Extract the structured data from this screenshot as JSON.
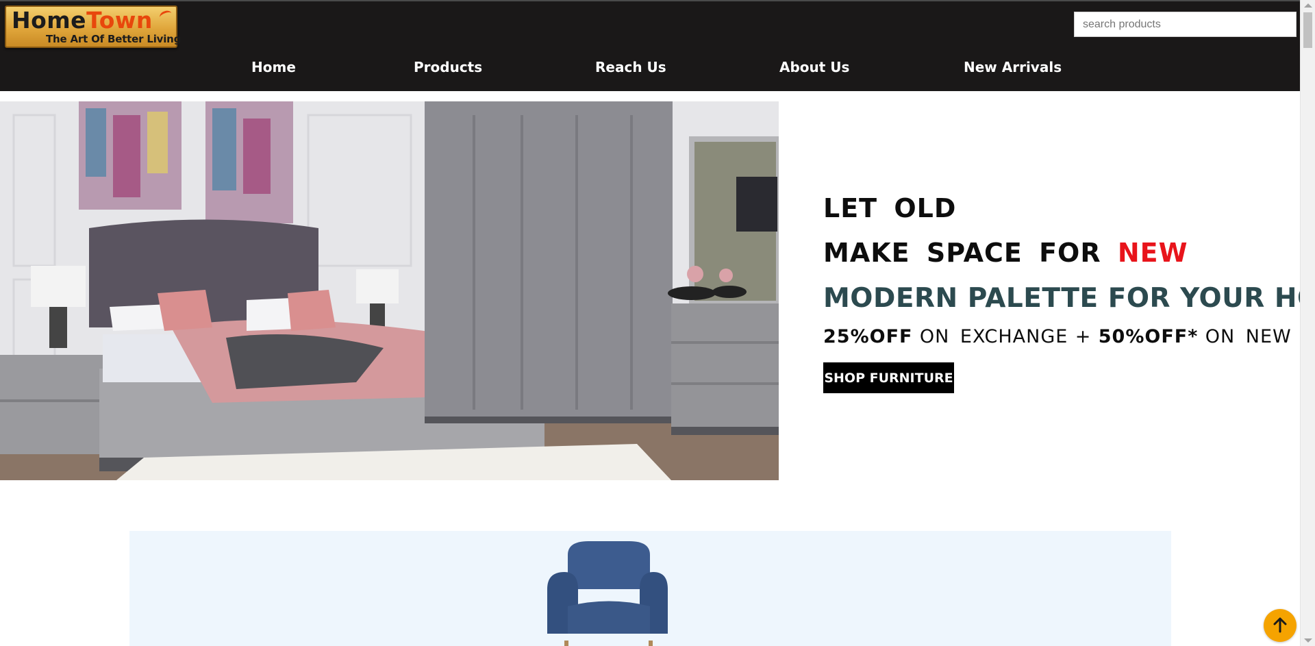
{
  "brand": {
    "name_part1": "Home",
    "name_part2": "Town",
    "tagline": "The Art Of Better Living"
  },
  "search": {
    "placeholder": "search products",
    "value": ""
  },
  "nav": {
    "items": [
      {
        "label": "Home"
      },
      {
        "label": "Products"
      },
      {
        "label": "Reach Us"
      },
      {
        "label": "About Us"
      },
      {
        "label": "New Arrivals"
      }
    ]
  },
  "hero": {
    "line1": "LET OLD",
    "line2_prefix": "MAKE SPACE FOR",
    "line2_highlight": "NEW",
    "line3": "MODERN PALETTE FOR YOUR HOME.",
    "offer1_value": "25%OFF",
    "offer1_text": "ON EXCHANGE",
    "offer_plus": "+",
    "offer2_value": "50%OFF*",
    "offer2_text": "ON NEW",
    "cta_label": "SHOP FURNITURE"
  },
  "colors": {
    "topbar": "#1a1818",
    "highlight_red": "#e8141b",
    "palette_teal": "#2c4a4f",
    "promo_bg": "#eef6fd",
    "to_top_button": "#f5a300",
    "brand_orange": "#e8470c"
  },
  "icons": {
    "back_to_top": "arrow-up-icon"
  }
}
